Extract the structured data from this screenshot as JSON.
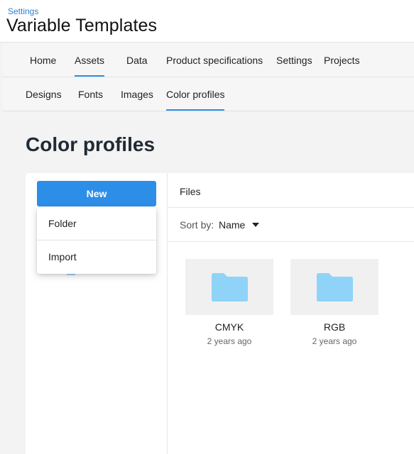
{
  "header": {
    "breadcrumb": "Settings",
    "app_title": "Variable Templates"
  },
  "nav": {
    "tabs": [
      {
        "label": "Home"
      },
      {
        "label": "Assets",
        "active": true
      },
      {
        "label": "Data"
      },
      {
        "label": "Product specifications"
      },
      {
        "label": "Settings"
      },
      {
        "label": "Projects"
      }
    ]
  },
  "subnav": {
    "tabs": [
      {
        "label": "Designs"
      },
      {
        "label": "Fonts"
      },
      {
        "label": "Images"
      },
      {
        "label": "Color profiles",
        "active": true
      }
    ]
  },
  "page": {
    "title": "Color profiles"
  },
  "sidebar": {
    "new_button": "New",
    "menu": [
      {
        "label": "Folder"
      },
      {
        "label": "Import"
      }
    ]
  },
  "files": {
    "header": "Files",
    "sort_label": "Sort by:",
    "sort_value": "Name",
    "items": [
      {
        "name": "CMYK",
        "date": "2 years ago",
        "icon": "folder-icon"
      },
      {
        "name": "RGB",
        "date": "2 years ago",
        "icon": "folder-icon"
      }
    ]
  },
  "colors": {
    "accent": "#2d8ee8",
    "folder": "#8fd3f8",
    "link": "#2f7fd3"
  }
}
